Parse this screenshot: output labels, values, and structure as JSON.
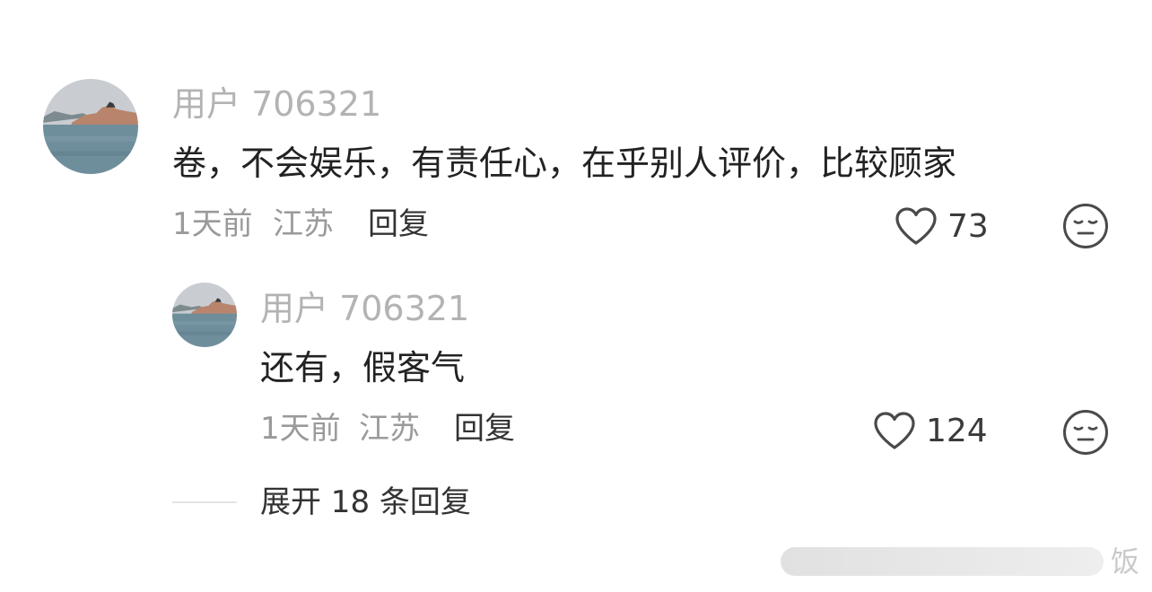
{
  "comments": [
    {
      "username": "用户 706321",
      "text": "卷，不会娱乐，有责任心，在乎别人评价，比较顾家",
      "time": "1天前",
      "location": "江苏",
      "reply_label": "回复",
      "likes": "73"
    },
    {
      "username": "用户 706321",
      "text": "还有，假客气",
      "time": "1天前",
      "location": "江苏",
      "reply_label": "回复",
      "likes": "124"
    }
  ],
  "expand_label": "展开 18 条回复",
  "watermark": {
    "char": "饭"
  },
  "icons": {
    "like": "heart-outline-icon",
    "emoji": "neutral-face-icon"
  }
}
